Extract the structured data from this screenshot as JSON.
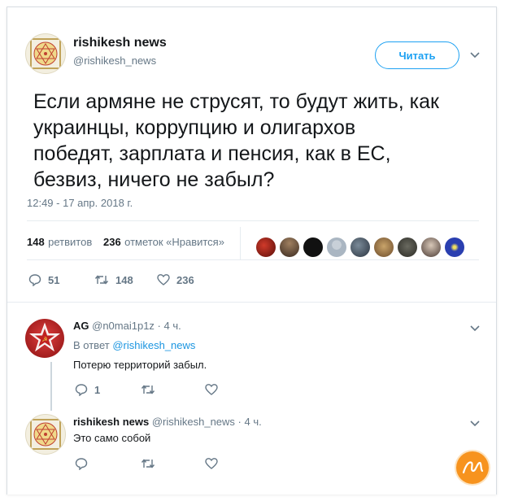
{
  "tweet": {
    "author_name": "rishikesh news",
    "author_handle": "@rishikesh_news",
    "follow_label": "Читать",
    "text": "Если армяне не струсят, то будут жить, как\nукраинцы, коррупцию и олигархов\nпобедят, зарплата и пенсия, как в ЕС,\nбезвиз, ничего не забыл?",
    "timestamp": "12:49 - 17 апр. 2018 г.",
    "retweets_count": "148",
    "retweets_label": "ретвитов",
    "likes_count": "236",
    "likes_label": "отметок «Нравится»",
    "actions": {
      "replies": "51",
      "retweets": "148",
      "likes": "236"
    }
  },
  "replies": [
    {
      "author_name": "AG",
      "author_handle": "@n0mai1p1z",
      "time": "· 4 ч.",
      "reply_to_prefix": "В ответ",
      "reply_to_handle": "@rishikesh_news",
      "text": "Потерю территорий забыл.",
      "reply_count": "1"
    },
    {
      "author_name": "rishikesh news",
      "author_handle": "@rishikesh_news",
      "time": "· 4 ч.",
      "text": "Это само собой"
    }
  ],
  "colors": {
    "accent": "#1da1f2",
    "muted": "#657786",
    "watermark": "#f7931e"
  }
}
